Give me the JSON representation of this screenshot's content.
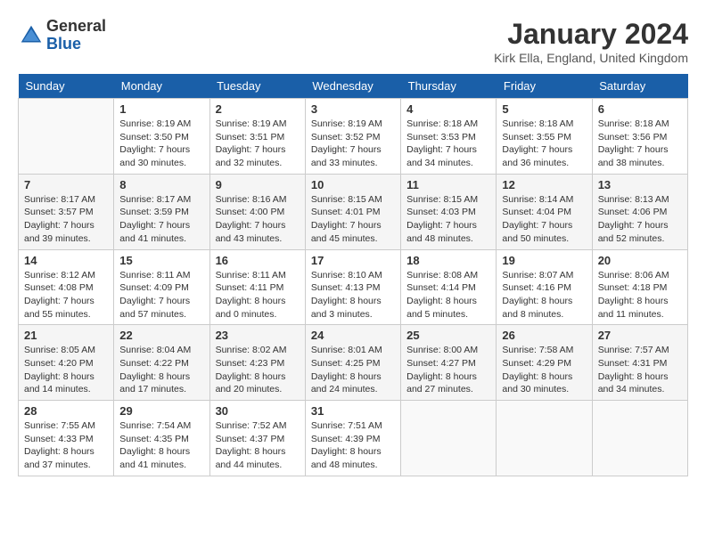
{
  "header": {
    "logo_general": "General",
    "logo_blue": "Blue",
    "title": "January 2024",
    "location": "Kirk Ella, England, United Kingdom"
  },
  "days_of_week": [
    "Sunday",
    "Monday",
    "Tuesday",
    "Wednesday",
    "Thursday",
    "Friday",
    "Saturday"
  ],
  "weeks": [
    [
      {
        "day": "",
        "info": ""
      },
      {
        "day": "1",
        "info": "Sunrise: 8:19 AM\nSunset: 3:50 PM\nDaylight: 7 hours\nand 30 minutes."
      },
      {
        "day": "2",
        "info": "Sunrise: 8:19 AM\nSunset: 3:51 PM\nDaylight: 7 hours\nand 32 minutes."
      },
      {
        "day": "3",
        "info": "Sunrise: 8:19 AM\nSunset: 3:52 PM\nDaylight: 7 hours\nand 33 minutes."
      },
      {
        "day": "4",
        "info": "Sunrise: 8:18 AM\nSunset: 3:53 PM\nDaylight: 7 hours\nand 34 minutes."
      },
      {
        "day": "5",
        "info": "Sunrise: 8:18 AM\nSunset: 3:55 PM\nDaylight: 7 hours\nand 36 minutes."
      },
      {
        "day": "6",
        "info": "Sunrise: 8:18 AM\nSunset: 3:56 PM\nDaylight: 7 hours\nand 38 minutes."
      }
    ],
    [
      {
        "day": "7",
        "info": "Sunrise: 8:17 AM\nSunset: 3:57 PM\nDaylight: 7 hours\nand 39 minutes."
      },
      {
        "day": "8",
        "info": "Sunrise: 8:17 AM\nSunset: 3:59 PM\nDaylight: 7 hours\nand 41 minutes."
      },
      {
        "day": "9",
        "info": "Sunrise: 8:16 AM\nSunset: 4:00 PM\nDaylight: 7 hours\nand 43 minutes."
      },
      {
        "day": "10",
        "info": "Sunrise: 8:15 AM\nSunset: 4:01 PM\nDaylight: 7 hours\nand 45 minutes."
      },
      {
        "day": "11",
        "info": "Sunrise: 8:15 AM\nSunset: 4:03 PM\nDaylight: 7 hours\nand 48 minutes."
      },
      {
        "day": "12",
        "info": "Sunrise: 8:14 AM\nSunset: 4:04 PM\nDaylight: 7 hours\nand 50 minutes."
      },
      {
        "day": "13",
        "info": "Sunrise: 8:13 AM\nSunset: 4:06 PM\nDaylight: 7 hours\nand 52 minutes."
      }
    ],
    [
      {
        "day": "14",
        "info": "Sunrise: 8:12 AM\nSunset: 4:08 PM\nDaylight: 7 hours\nand 55 minutes."
      },
      {
        "day": "15",
        "info": "Sunrise: 8:11 AM\nSunset: 4:09 PM\nDaylight: 7 hours\nand 57 minutes."
      },
      {
        "day": "16",
        "info": "Sunrise: 8:11 AM\nSunset: 4:11 PM\nDaylight: 8 hours\nand 0 minutes."
      },
      {
        "day": "17",
        "info": "Sunrise: 8:10 AM\nSunset: 4:13 PM\nDaylight: 8 hours\nand 3 minutes."
      },
      {
        "day": "18",
        "info": "Sunrise: 8:08 AM\nSunset: 4:14 PM\nDaylight: 8 hours\nand 5 minutes."
      },
      {
        "day": "19",
        "info": "Sunrise: 8:07 AM\nSunset: 4:16 PM\nDaylight: 8 hours\nand 8 minutes."
      },
      {
        "day": "20",
        "info": "Sunrise: 8:06 AM\nSunset: 4:18 PM\nDaylight: 8 hours\nand 11 minutes."
      }
    ],
    [
      {
        "day": "21",
        "info": "Sunrise: 8:05 AM\nSunset: 4:20 PM\nDaylight: 8 hours\nand 14 minutes."
      },
      {
        "day": "22",
        "info": "Sunrise: 8:04 AM\nSunset: 4:22 PM\nDaylight: 8 hours\nand 17 minutes."
      },
      {
        "day": "23",
        "info": "Sunrise: 8:02 AM\nSunset: 4:23 PM\nDaylight: 8 hours\nand 20 minutes."
      },
      {
        "day": "24",
        "info": "Sunrise: 8:01 AM\nSunset: 4:25 PM\nDaylight: 8 hours\nand 24 minutes."
      },
      {
        "day": "25",
        "info": "Sunrise: 8:00 AM\nSunset: 4:27 PM\nDaylight: 8 hours\nand 27 minutes."
      },
      {
        "day": "26",
        "info": "Sunrise: 7:58 AM\nSunset: 4:29 PM\nDaylight: 8 hours\nand 30 minutes."
      },
      {
        "day": "27",
        "info": "Sunrise: 7:57 AM\nSunset: 4:31 PM\nDaylight: 8 hours\nand 34 minutes."
      }
    ],
    [
      {
        "day": "28",
        "info": "Sunrise: 7:55 AM\nSunset: 4:33 PM\nDaylight: 8 hours\nand 37 minutes."
      },
      {
        "day": "29",
        "info": "Sunrise: 7:54 AM\nSunset: 4:35 PM\nDaylight: 8 hours\nand 41 minutes."
      },
      {
        "day": "30",
        "info": "Sunrise: 7:52 AM\nSunset: 4:37 PM\nDaylight: 8 hours\nand 44 minutes."
      },
      {
        "day": "31",
        "info": "Sunrise: 7:51 AM\nSunset: 4:39 PM\nDaylight: 8 hours\nand 48 minutes."
      },
      {
        "day": "",
        "info": ""
      },
      {
        "day": "",
        "info": ""
      },
      {
        "day": "",
        "info": ""
      }
    ]
  ]
}
